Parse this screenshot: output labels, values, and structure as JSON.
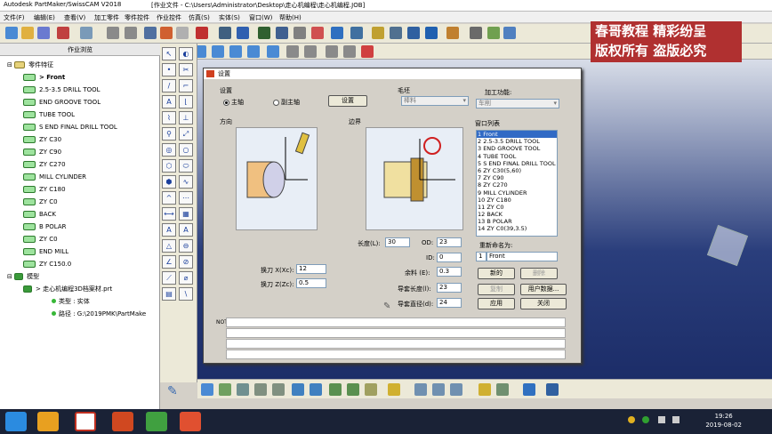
{
  "titlebar": {
    "app_title": "Autodesk PartMaker/SwissCAM V2018",
    "doc_path": "[作业文件 - C:\\Users\\Administrator\\Desktop\\走心机编程\\走心机编程.JOB]"
  },
  "menubar": {
    "items": [
      "文件(F)",
      "编辑(E)",
      "查看(V)",
      "加工零件",
      "零件控件",
      "作业控件",
      "仿真(S)",
      "实体(S)",
      "窗口(W)",
      "帮助(H)"
    ]
  },
  "watermark": {
    "line1": "春哥教程  精彩纷呈",
    "line2": "版权所有  盗版必究"
  },
  "left_panel": {
    "header": "作业浏览",
    "root": "零件特征",
    "items": [
      "> Front",
      "2.5-3.5 DRILL TOOL",
      "END GROOVE TOOL",
      "TUBE TOOL",
      "S END FINAL DRILL TOOL",
      "ZY C30",
      "ZY C90",
      "ZY C270",
      "MILL CYLINDER",
      "ZY C180",
      "ZY C0",
      "BACK",
      "B POLAR",
      "ZY C0",
      "END MILL",
      "ZY C150.0"
    ],
    "model_root": "模型",
    "model_item": "> 走心机编程3D档案材.prt",
    "model_type": "类型 : 实体",
    "model_path": "路径 : G:\\2019PMK\\PartMake"
  },
  "dialog": {
    "title": "设置",
    "setup_label": "设置",
    "radio_main": "主轴",
    "radio_sub": "副主轴",
    "setup_button": "设置",
    "blank_label": "毛坯",
    "blank_value": "棒料",
    "process_label": "加工功能:",
    "process_value": "车削",
    "direction_label": "方向",
    "boundary_label": "边界",
    "window_list_label": "窗口列表",
    "operations": [
      "1 Front",
      "2 2.5-3.5 DRILL TOOL",
      "3 END GROOVE TOOL",
      "4 TUBE TOOL",
      "5 S END FINAL DRILL TOOL",
      "6 ZY C30(5,60)",
      "7 ZY C90",
      "8 ZY C270",
      "9 MILL CYLINDER",
      "10 ZY C180",
      "11 ZY C0",
      "12 BACK",
      "13 B POLAR",
      "14 ZY C0(39,3.5)"
    ],
    "rename_label": "重新命名为:",
    "rename_index": "1",
    "rename_value": "Front",
    "length_label": "长度(L):",
    "length_value": "30",
    "od_label": "OD:",
    "od_value": "23",
    "id_label": "ID:",
    "id_value": "0",
    "tool_x_label": "换刀 X(Xc):",
    "tool_x_value": "12",
    "tool_z_label": "换刀 Z(Zc):",
    "tool_z_value": "0.5",
    "allowance_label": "余料 (E):",
    "allowance_value": "0.3",
    "guide_length_label": "导套长度(l):",
    "guide_length_value": "23",
    "guide_dia_label": "导套直径(d):",
    "guide_dia_value": "24",
    "btn_new": "新的",
    "btn_delete": "删除",
    "btn_copy": "复制",
    "btn_user_data": "用户数据...",
    "btn_apply": "应用",
    "btn_close": "关闭",
    "notes_label": "NOTES"
  },
  "clock": {
    "time": "19:26",
    "date": "2019-08-02"
  },
  "colors": {
    "accent": "#316ac5",
    "watermark": "#b03030",
    "taskbar": "#1a2236"
  }
}
